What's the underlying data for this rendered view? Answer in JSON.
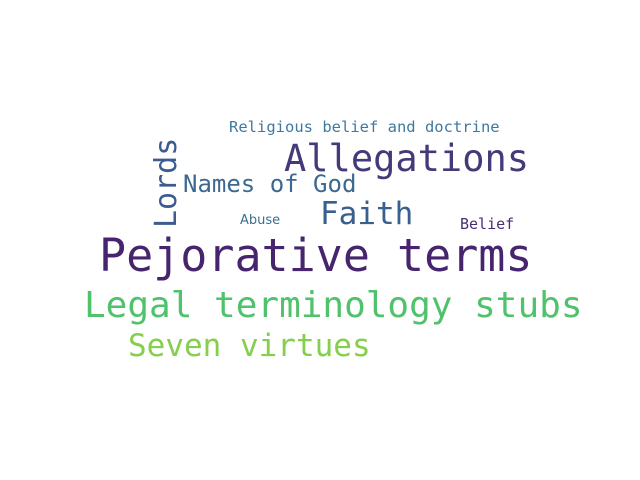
{
  "words": [
    {
      "text": "Religious belief and doctrine",
      "color": "#3e7aa0"
    },
    {
      "text": "Allegations",
      "color": "#433a7a"
    },
    {
      "text": "Lords",
      "color": "#3c5c8f"
    },
    {
      "text": "Names of God",
      "color": "#3d6990"
    },
    {
      "text": "Faith",
      "color": "#37608c"
    },
    {
      "text": "Abuse",
      "color": "#3b6f93"
    },
    {
      "text": "Belief",
      "color": "#4a2e73"
    },
    {
      "text": "Pejorative terms",
      "color": "#46246e"
    },
    {
      "text": "Legal terminology stubs",
      "color": "#4fc26b"
    },
    {
      "text": "Seven virtues",
      "color": "#86cf4c"
    }
  ]
}
